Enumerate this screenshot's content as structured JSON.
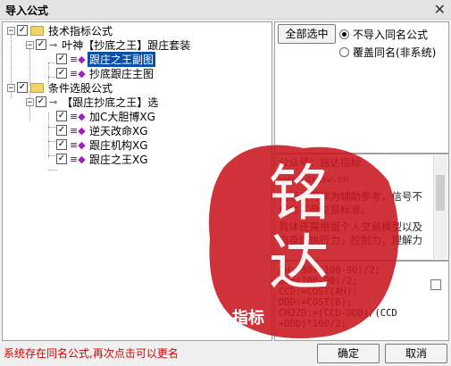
{
  "window": {
    "title": "导入公式",
    "close_glyph": "✕"
  },
  "tree": {
    "nodes": [
      {
        "label": "技术指标公式",
        "kind": "folder",
        "expander": "−"
      },
      {
        "label": "叶神【抄底之王】跟庄套装",
        "kind": "key",
        "expander": "−"
      },
      {
        "label": "跟庄之王副图",
        "kind": "formula",
        "selected": true
      },
      {
        "label": "抄底跟庄主图",
        "kind": "formula"
      },
      {
        "label": "条件选股公式",
        "kind": "folder",
        "expander": "−"
      },
      {
        "label": "【跟庄抄底之王】选",
        "kind": "key",
        "expander": "−"
      },
      {
        "label": "加C大胆博XG",
        "kind": "formula"
      },
      {
        "label": "逆天改命XG",
        "kind": "formula"
      },
      {
        "label": "跟庄机构XG",
        "kind": "formula"
      },
      {
        "label": "跟庄之王XG",
        "kind": "formula"
      }
    ],
    "check_glyph": "✓"
  },
  "options": {
    "select_all": "全部选中",
    "radio1": "不导入同名公式",
    "radio2": "覆盖同名(非系统)"
  },
  "description": {
    "line1": "公众号：铭达指标",
    "line2": "www.tdxgsw.cn",
    "line3": "指标只可作为辅助参考，信号不作为实盘交易标准。",
    "line4": "具体还需根据个人交易模型以及自身的执行力，控制力，理解力"
  },
  "code": {
    "lines": [
      "AH:=90+(100-90)/2;",
      "B:=(100-90)/2;",
      "CCD:=COST(AH);",
      "DDD:=COST(B);",
      "CMJZD:=(CCD-DDD)/(CCD",
      "+DDD)*100/2;"
    ]
  },
  "status_text": "系统存在同名公式,再次点击可以更名",
  "buttons": {
    "ok": "确定",
    "cancel": "取消"
  },
  "watermark": {
    "char1": "铭",
    "char2": "达",
    "caption": "指标"
  },
  "colors": {
    "selection": "#0a4fa8",
    "status": "#d40000",
    "seal": "#c8161d",
    "formula_icon": "#a020c0"
  }
}
